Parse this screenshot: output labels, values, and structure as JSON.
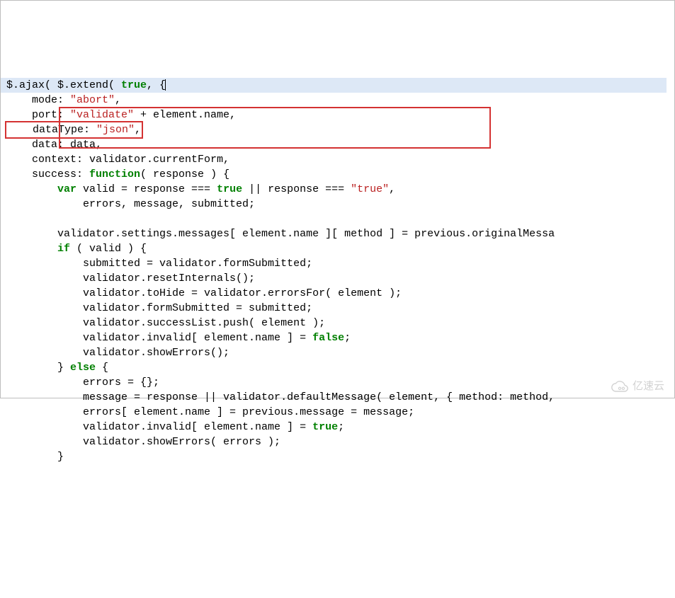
{
  "code": {
    "l1": {
      "pre": "$.ajax( $.extend( ",
      "kw": "true",
      "post": ", {"
    },
    "l2": {
      "pre": "    mode: ",
      "str": "\"abort\"",
      "post": ","
    },
    "l3": {
      "pre": "    port: ",
      "str": "\"validate\"",
      "post": " + element.name,"
    },
    "l4": {
      "pre": "    dataType: ",
      "str": "\"json\"",
      "post": ","
    },
    "l5": "    data: data,",
    "l6": "    context: validator.currentForm,",
    "l7": {
      "pre": "    success: ",
      "kw": "function",
      "post": "( response ) {"
    },
    "l8": {
      "p1": "        ",
      "kw1": "var",
      "p2": " valid = response === ",
      "kw2": "true",
      "p3": " || response === ",
      "str": "\"true\"",
      "p4": ","
    },
    "l9": "            errors, message, submitted;",
    "l10": "",
    "l11": "        validator.settings.messages[ element.name ][ method ] = previous.originalMessa",
    "l12": {
      "p1": "        ",
      "kw": "if",
      "p2": " ( valid ) {"
    },
    "l13": "            submitted = validator.formSubmitted;",
    "l14": "            validator.resetInternals();",
    "l15": "            validator.toHide = validator.errorsFor( element );",
    "l16": "            validator.formSubmitted = submitted;",
    "l17": "            validator.successList.push( element );",
    "l18": {
      "p1": "            validator.invalid[ element.name ] = ",
      "kw": "false",
      "p2": ";"
    },
    "l19": "            validator.showErrors();",
    "l20": {
      "p1": "        } ",
      "kw": "else",
      "p2": " {"
    },
    "l21": "            errors = {};",
    "l22": "            message = response || validator.defaultMessage( element, { method: method,",
    "l23": "            errors[ element.name ] = previous.message = message;",
    "l24": {
      "p1": "            validator.invalid[ element.name ] = ",
      "kw": "true",
      "p2": ";"
    },
    "l25": "            validator.showErrors( errors );",
    "l26": "        }"
  },
  "watermark": {
    "text": "亿速云"
  }
}
